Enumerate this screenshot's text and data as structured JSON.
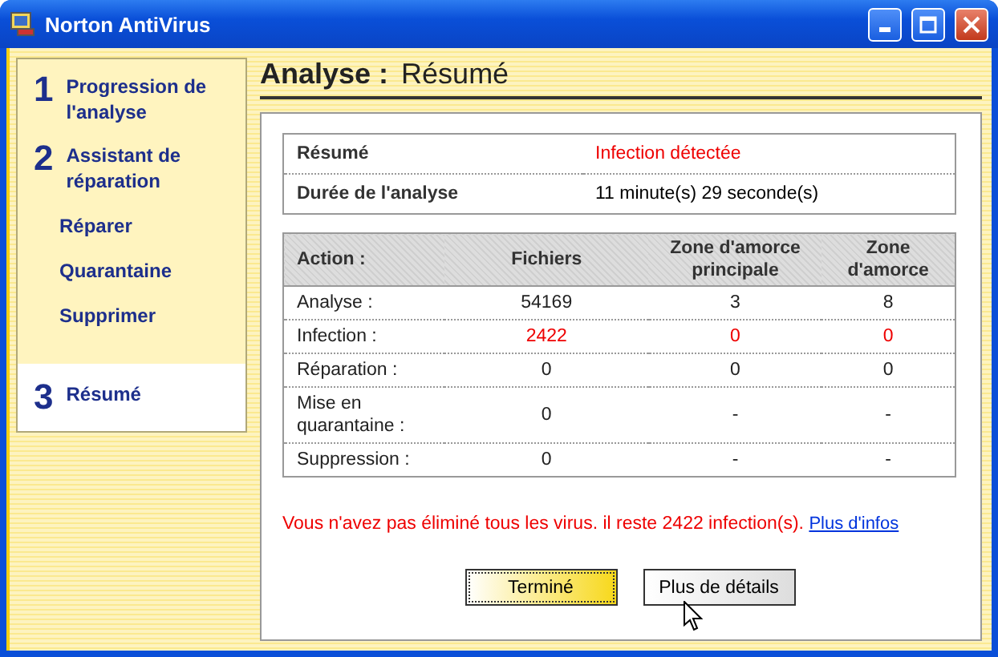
{
  "window": {
    "title": "Norton AntiVirus"
  },
  "sidebar": {
    "items": [
      {
        "number": "1",
        "label": "Progression de l'analyse",
        "selected": false
      },
      {
        "number": "2",
        "label": "Assistant de réparation",
        "selected": false,
        "children": [
          {
            "label": "Réparer",
            "selected": false
          },
          {
            "label": "Quarantaine",
            "selected": false
          },
          {
            "label": "Supprimer",
            "selected": false
          }
        ]
      },
      {
        "number": "3",
        "label": "Résumé",
        "selected": true
      }
    ]
  },
  "heading": {
    "title": "Analyse :",
    "subtitle": "Résumé"
  },
  "summary": [
    {
      "label": "Résumé",
      "value": "Infection détectée",
      "alert": true
    },
    {
      "label": "Durée de l'analyse",
      "value": "11 minute(s) 29 seconde(s)",
      "alert": false
    }
  ],
  "results": {
    "columns": [
      "Action :",
      "Fichiers",
      "Zone d'amorce principale",
      "Zone d'amorce"
    ],
    "rows": [
      {
        "cells": [
          "Analyse :",
          "54169",
          "3",
          "8"
        ],
        "alert": false
      },
      {
        "cells": [
          "Infection :",
          "2422",
          "0",
          "0"
        ],
        "alert": true
      },
      {
        "cells": [
          "Réparation :",
          "0",
          "0",
          "0"
        ],
        "alert": false
      },
      {
        "cells": [
          "Mise en quarantaine :",
          "0",
          "-",
          "-"
        ],
        "alert": false
      },
      {
        "cells": [
          "Suppression :",
          "0",
          "-",
          "-"
        ],
        "alert": false
      }
    ]
  },
  "message": {
    "text": "Vous n'avez pas éliminé tous les virus. il reste 2422 infection(s).",
    "link": "Plus d'infos"
  },
  "buttons": [
    {
      "label": "Terminé",
      "default": true
    },
    {
      "label": "Plus de détails",
      "default": false
    }
  ]
}
